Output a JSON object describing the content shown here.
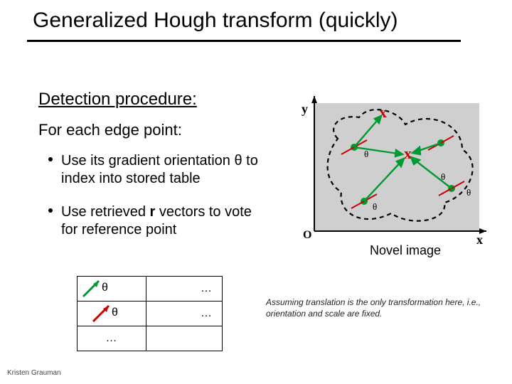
{
  "title": "Generalized Hough transform (quickly)",
  "subtitle": "Detection procedure:",
  "lead": "For each edge point:",
  "bullets": [
    "Use its gradient orientation θ to index into stored table",
    "Use retrieved r vectors to vote for reference point"
  ],
  "table": {
    "rows": [
      {
        "theta": "θ",
        "vec": "…",
        "arrowColor": "green",
        "arrowIndent": 6
      },
      {
        "theta": "θ",
        "vec": "…",
        "arrowColor": "red",
        "arrowIndent": 20
      },
      {
        "theta": "…",
        "vec": ""
      }
    ]
  },
  "diagram": {
    "x_label": "x",
    "y_label": "y",
    "origin_label": "O",
    "theta_label": "θ",
    "caption": "Novel image"
  },
  "assumption": "Assuming translation is the only transformation here, i.e., orientation and scale are fixed.",
  "footer": "Kristen Grauman"
}
